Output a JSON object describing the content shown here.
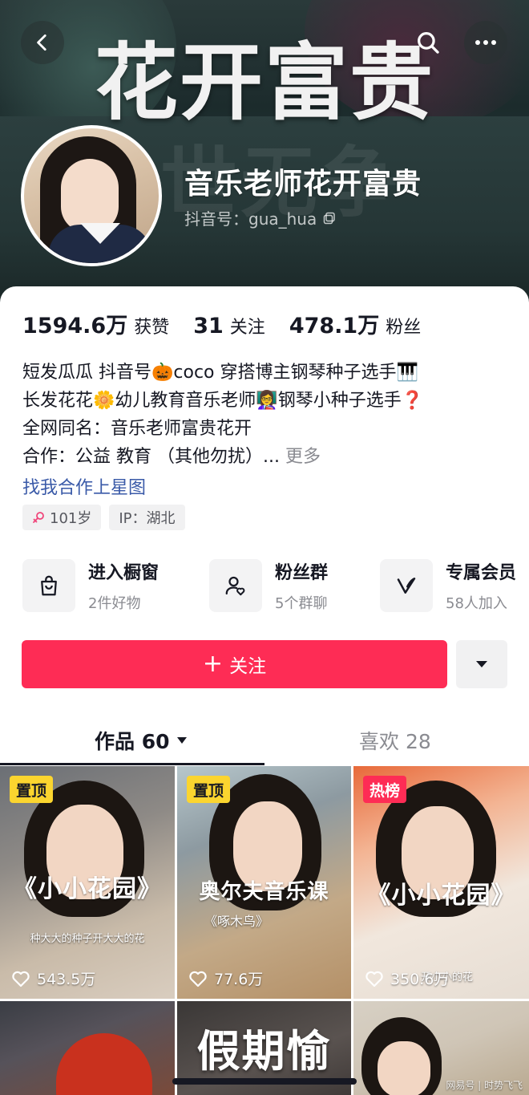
{
  "cover": {
    "title": "花开富贵",
    "watermark": "世无争"
  },
  "profile": {
    "nickname": "音乐老师花开富贵",
    "douyin_id": "抖音号：gua_hua"
  },
  "stats": [
    {
      "value": "1594.6万",
      "label": "获赞"
    },
    {
      "value": "31",
      "label": "关注"
    },
    {
      "value": "478.1万",
      "label": "粉丝"
    }
  ],
  "bio": {
    "line1": "短发瓜瓜 抖音号🎃coco 穿搭博主钢琴种子选手🎹",
    "line2": "长发花花🌼幼儿教育音乐老师👩‍🏫钢琴小种子选手❓",
    "line3": "全网同名：音乐老师富贵花开",
    "line4": "合作：公益 教育 （其他勿扰）... ",
    "more": "更多",
    "star_link": "找我合作上星图"
  },
  "tags": {
    "age": "101岁",
    "ip": "IP：湖北"
  },
  "features": [
    {
      "title": "进入橱窗",
      "sub": "2件好物",
      "icon": "shopping-bag-icon"
    },
    {
      "title": "粉丝群",
      "sub": "5个群聊",
      "icon": "fan-group-icon"
    },
    {
      "title": "专属会员",
      "sub": "58人加入",
      "icon": "vip-icon"
    }
  ],
  "follow": {
    "label": "关注"
  },
  "tabs": {
    "works": "作品 60",
    "likes": "喜欢 28"
  },
  "videos": [
    {
      "badge": "置顶",
      "caption": "《小小花园》",
      "sub": "种大大的种子开大大的花",
      "likes": "543.5万"
    },
    {
      "badge": "置顶",
      "caption": "奥尔夫音乐课",
      "sub": "《啄木鸟》",
      "likes": "77.6万"
    },
    {
      "badge": "热榜",
      "caption": "《小小花园》",
      "sub": "开小小的花",
      "likes": "350.6万"
    },
    {
      "caption": ""
    },
    {
      "caption": "假期愉"
    },
    {
      "caption": ""
    }
  ],
  "footer": {
    "watermark": "网易号 | 时势飞飞"
  },
  "colors": {
    "accent": "#fe2c55",
    "pin_badge": "#fbd52f",
    "link": "#3a5aa8"
  }
}
